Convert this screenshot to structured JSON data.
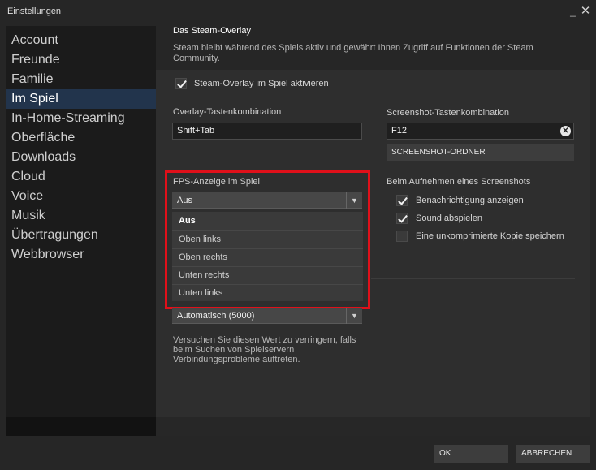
{
  "window": {
    "title": "Einstellungen"
  },
  "sidebar": {
    "items": [
      {
        "label": "Account"
      },
      {
        "label": "Freunde"
      },
      {
        "label": "Familie"
      },
      {
        "label": "Im Spiel"
      },
      {
        "label": "In-Home-Streaming"
      },
      {
        "label": "Oberfläche"
      },
      {
        "label": "Downloads"
      },
      {
        "label": "Cloud"
      },
      {
        "label": "Voice"
      },
      {
        "label": "Musik"
      },
      {
        "label": "Übertragungen"
      },
      {
        "label": "Webbrowser"
      }
    ],
    "active": "Im Spiel"
  },
  "overlay": {
    "title": "Das Steam-Overlay",
    "description": "Steam bleibt während des Spiels aktiv und gewährt Ihnen Zugriff auf Funktionen der Steam Community.",
    "enable_label": "Steam-Overlay im Spiel aktivieren",
    "enable_checked": true,
    "hotkey_label": "Overlay-Tastenkombination",
    "hotkey_value": "Shift+Tab"
  },
  "screenshot": {
    "hotkey_label": "Screenshot-Tastenkombination",
    "hotkey_value": "F12",
    "folder_button": "SCREENSHOT-ORDNER",
    "on_capture_label": "Beim Aufnehmen eines Screenshots",
    "options": [
      {
        "label": "Benachrichtigung anzeigen",
        "checked": true
      },
      {
        "label": "Sound abspielen",
        "checked": true
      },
      {
        "label": "Eine unkomprimierte Kopie speichern",
        "checked": false
      }
    ]
  },
  "fps": {
    "label": "FPS-Anzeige im Spiel",
    "selected": "Aus",
    "options": [
      "Aus",
      "Oben links",
      "Oben rechts",
      "Unten rechts",
      "Unten links"
    ]
  },
  "network": {
    "selected": "Automatisch (5000)",
    "description": "Versuchen Sie diesen Wert zu verringern, falls beim Suchen von Spielservern Verbindungsprobleme auftreten."
  },
  "footer": {
    "ok": "OK",
    "cancel": "ABBRECHEN"
  },
  "colors": {
    "highlight_border": "#e0101a",
    "active_nav": "#22344c"
  }
}
